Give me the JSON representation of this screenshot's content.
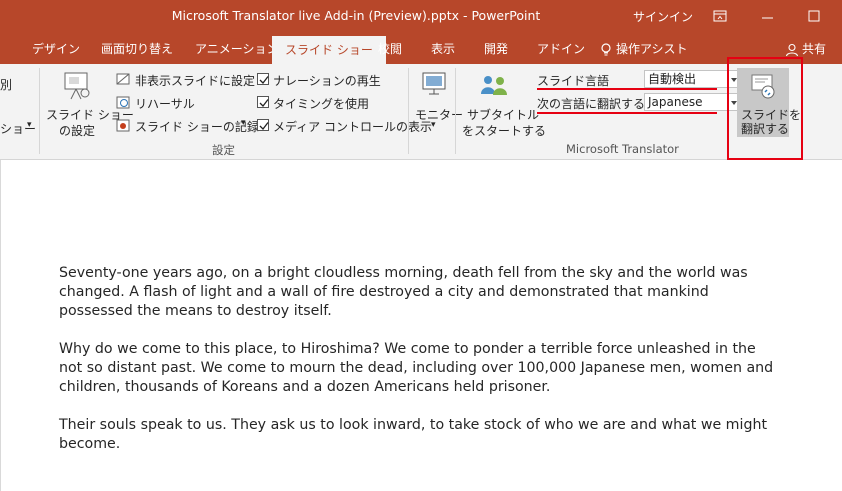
{
  "window": {
    "title": "Microsoft Translator live Add-in (Preview).pptx - PowerPoint",
    "signin": "サインイン"
  },
  "tabs": {
    "items": [
      {
        "label": "デザイン"
      },
      {
        "label": "画面切り替え"
      },
      {
        "label": "アニメーション"
      },
      {
        "label": "スライド ショー"
      },
      {
        "label": "校閲"
      },
      {
        "label": "表示"
      },
      {
        "label": "開発"
      },
      {
        "label": "アドイン"
      }
    ],
    "tell_me": "操作アシスト",
    "share": "共有"
  },
  "ribbon": {
    "partial_left_1": "別",
    "partial_left_2": "ショー",
    "slideshow_setup_1": "スライド ショー",
    "slideshow_setup_2": "の設定",
    "hide_slide": "非表示スライドに設定",
    "rehearse": "リハーサル",
    "record": "スライド ショーの記録",
    "play_narration": "ナレーションの再生",
    "use_timings": "タイミングを使用",
    "show_media_controls": "メディア コントロールの表示",
    "group_setup": "設定",
    "monitor": "モニター",
    "subtitles_1": "サブタイトル",
    "subtitles_2": "をスタートする",
    "slide_language_label": "スライド言語",
    "slide_language_value": "自動検出",
    "translate_to_label": "次の言語に翻訳する:",
    "translate_to_value": "Japanese",
    "translate_slide_1": "スライドを",
    "translate_slide_2": "翻訳する",
    "group_translator": "Microsoft Translator"
  },
  "slide": {
    "paragraphs": [
      {
        "lines": [
          "Seventy-one years ago, on a bright cloudless morning, death fell from the sky and the world was",
          "changed. A flash of light and a wall of fire destroyed a city and demonstrated that mankind",
          "possessed the means to destroy itself."
        ]
      },
      {
        "lines": [
          "Why do we come to this place, to Hiroshima? We come to ponder a terrible force unleashed in the",
          "not so distant past. We come to mourn the dead, including over 100,000 Japanese men, women and",
          "children, thousands of Koreans and a dozen Americans held prisoner."
        ]
      },
      {
        "lines": [
          "Their souls speak to us. They ask us to look inward, to take stock of who we are and what we might",
          "become."
        ]
      }
    ]
  },
  "colors": {
    "accent": "#b7472a",
    "highlight": "#e60012"
  }
}
